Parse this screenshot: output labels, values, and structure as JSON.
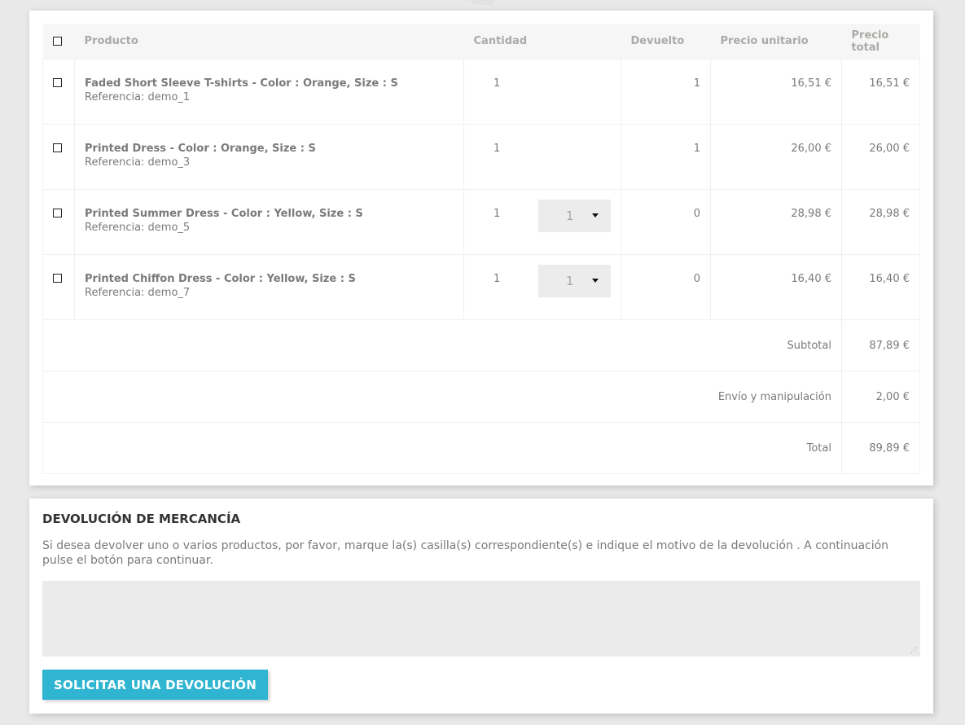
{
  "table": {
    "headers": {
      "product": "Producto",
      "quantity": "Cantidad",
      "returned": "Devuelto",
      "unit_price": "Precio unitario",
      "total_price": "Precio total"
    },
    "rows": [
      {
        "name": "Faded Short Sleeve T-shirts - Color : Orange, Size : S",
        "ref": "Referencia: demo_1",
        "qty": "1",
        "returned": "1",
        "unit": "16,51 €",
        "total": "16,51 €"
      },
      {
        "name": "Printed Dress - Color : Orange, Size : S",
        "ref": "Referencia: demo_3",
        "qty": "1",
        "returned": "1",
        "unit": "26,00 €",
        "total": "26,00 €"
      },
      {
        "name": "Printed Summer Dress - Color : Yellow, Size : S",
        "ref": "Referencia: demo_5",
        "qty": "1",
        "select_value": "1",
        "returned": "0",
        "unit": "28,98 €",
        "total": "28,98 €"
      },
      {
        "name": "Printed Chiffon Dress - Color : Yellow, Size : S",
        "ref": "Referencia: demo_7",
        "qty": "1",
        "select_value": "1",
        "returned": "0",
        "unit": "16,40 €",
        "total": "16,40 €"
      }
    ],
    "summary": {
      "subtotal_label": "Subtotal",
      "subtotal_value": "87,89 €",
      "shipping_label": "Envío y manipulación",
      "shipping_value": "2,00 €",
      "total_label": "Total",
      "total_value": "89,89 €"
    }
  },
  "returns": {
    "title": "DEVOLUCIÓN DE MERCANCÍA",
    "description": "Si desea devolver uno o varios productos, por favor, marque la(s) casilla(s) correspondiente(s) e indique el motivo de la devolución . A continuación pulse el botón para continuar.",
    "textarea_value": "",
    "button_label": "SOLICITAR UNA DEVOLUCIÓN"
  },
  "colors": {
    "accent": "#2fb5d2",
    "background": "#e9e9e9"
  }
}
